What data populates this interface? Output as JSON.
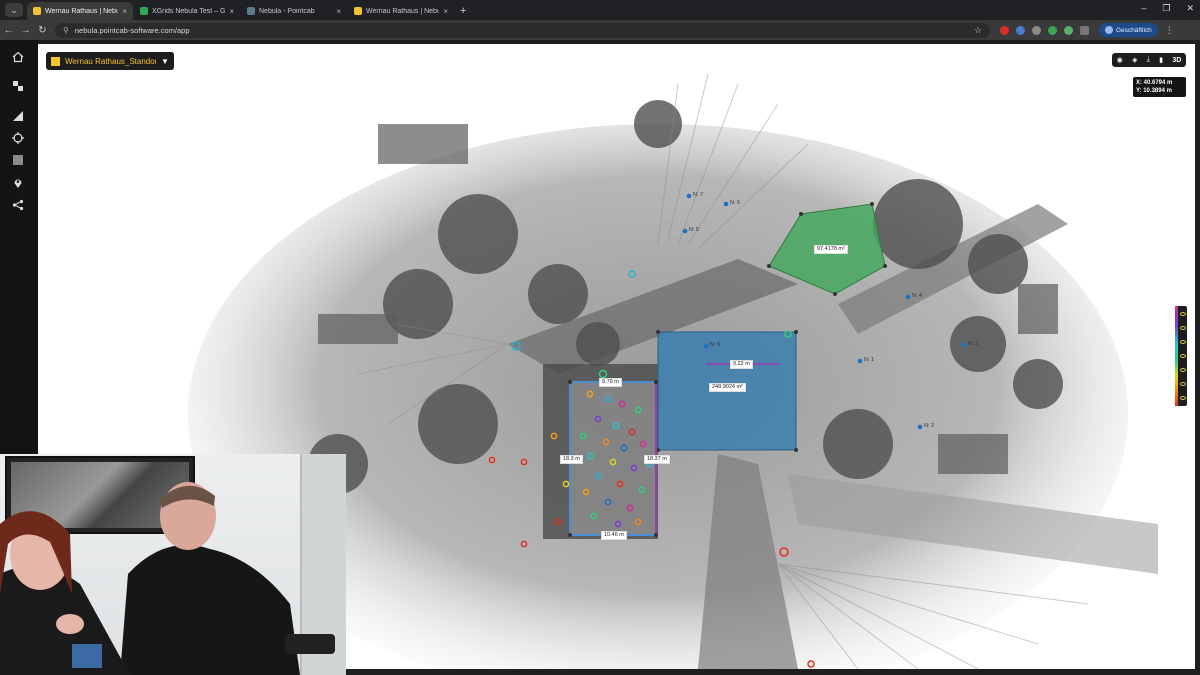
{
  "browser": {
    "tabs": [
      {
        "title": "Wernau Rathaus | Nebula Viewer",
        "active": true,
        "favicon": "#f5c230"
      },
      {
        "title": "XGrids Nebula Test – Google Dr",
        "active": false,
        "favicon": "#34a853"
      },
      {
        "title": "Nebula - Pointcab",
        "active": false,
        "favicon": "#5f7a8a"
      },
      {
        "title": "Wernau Rathaus | Nebula Viewer",
        "active": false,
        "favicon": "#f5c230"
      }
    ],
    "close_glyph": "×",
    "new_tab_glyph": "+",
    "url": "nebula.pointcab-software.com/app",
    "profile_label": "Geschäftlich"
  },
  "app": {
    "project_name": "Wernau Rathaus_Standort",
    "view_mode": "3D",
    "coords": {
      "x": "X: 40.6794 m",
      "y": "Y: 10.3894 m"
    }
  },
  "measurements": {
    "area_green": "97.4178 m²",
    "area_blue": "248.9024 m²",
    "dist_blue_inner": "9.22 m",
    "dist_building_top": "9.79 m",
    "dist_building_left": "18.3 m",
    "dist_building_right": "18.37 m",
    "dist_building_bottom": "10.46 m"
  },
  "markers": [
    "N: 7",
    "N: 6",
    "N: 5",
    "N: 4",
    "N: 3",
    "N: 1",
    "N: 2",
    "N: 0"
  ],
  "colors": {
    "accent": "#f5c230",
    "area_green": "#3ea75a",
    "area_blue": "#3b7fae",
    "measure_purple": "#9b3bb8",
    "marker_blue": "#1f6fc4"
  }
}
